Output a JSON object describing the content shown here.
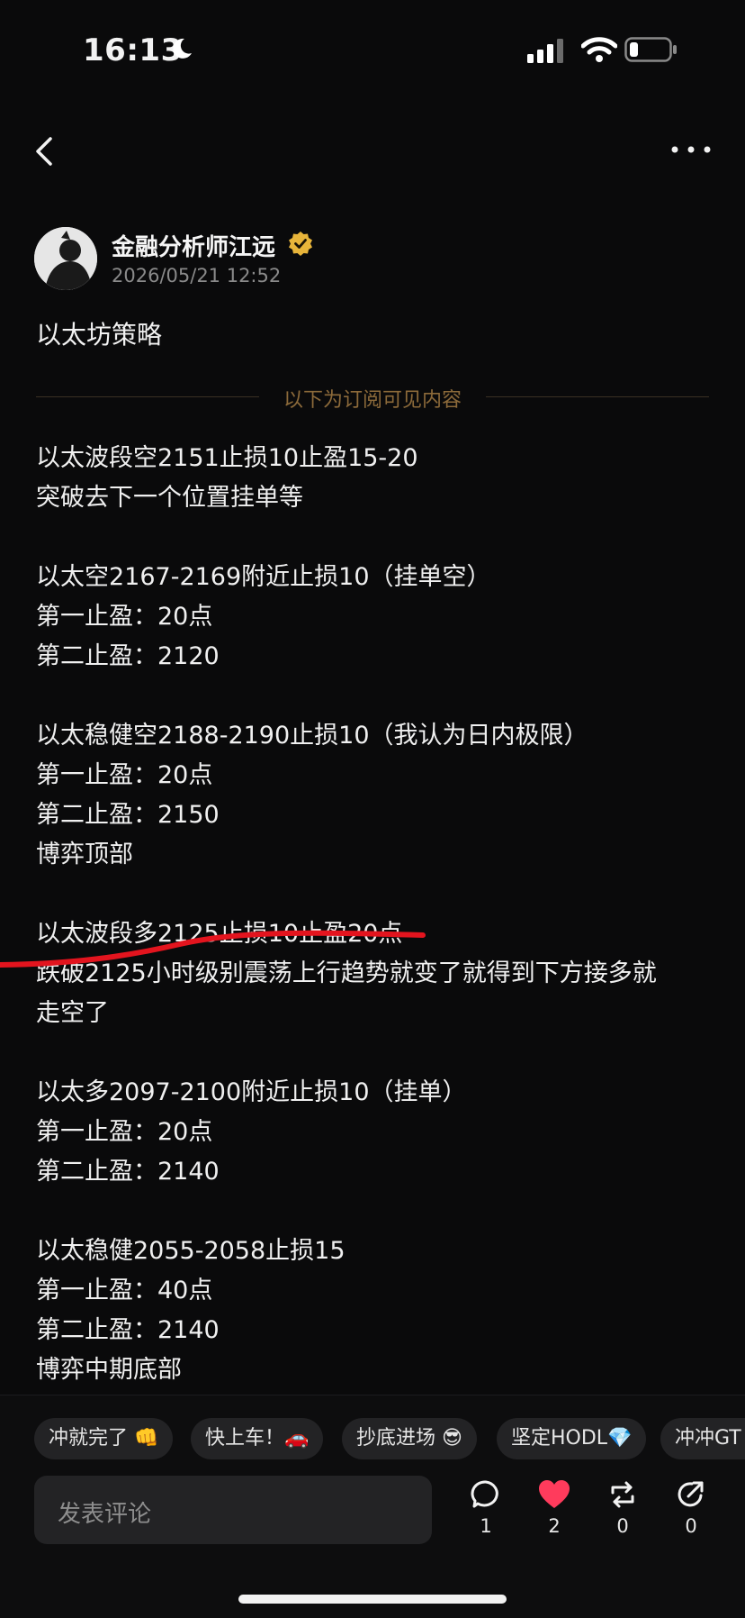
{
  "status_bar": {
    "time": "16:13"
  },
  "post": {
    "author": "金融分析师江远",
    "date": "2026/05/21 12:52",
    "title": "以太坊策略",
    "divider_text": "以下为订阅可见内容",
    "lines": [
      "以太波段空2151止损10止盈15-20",
      "突破去下一个位置挂单等",
      "以太空2167-2169附近止损10（挂单空）",
      "第一止盈：20点",
      "第二止盈：2120",
      "以太稳健空2188-2190止损10（我认为日内极限）",
      "第一止盈：20点",
      "第二止盈：2150",
      "博弈顶部",
      "以太波段多2125止损10止盈20点",
      "跌破2125小时级别震荡上行趋势就变了就得到下方接多就",
      "走空了",
      "以太多2097-2100附近止损10（挂单）",
      "第一止盈：20点",
      "第二止盈：2140",
      "以太稳健2055-2058止损15",
      "第一止盈：40点",
      "第二止盈：2140",
      "博弈中期底部"
    ]
  },
  "quick_replies": [
    "冲就完了 👊",
    "快上车！🚗",
    "抄底进场 😎",
    "坚定HODL💎",
    "冲冲GT"
  ],
  "comment": {
    "placeholder": "发表评论"
  },
  "actions": {
    "comments": "1",
    "likes": "2",
    "reposts": "0",
    "shares": "0"
  },
  "colors": {
    "background": "#0a0a0b",
    "divider_text": "#8c6a3a",
    "verified_badge": "#e7b43a",
    "like": "#ff3b5c",
    "annotation_red": "#e3141e"
  }
}
